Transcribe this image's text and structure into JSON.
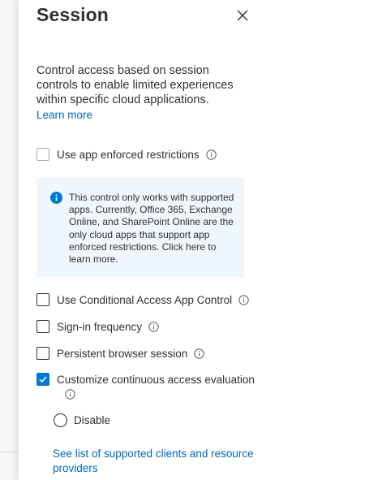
{
  "panel": {
    "title": "Session",
    "description": "Control access based on session controls to enable limited experiences within specific cloud applications.",
    "learn_more": "Learn more"
  },
  "options": [
    {
      "label": "Use app enforced restrictions",
      "checked": false,
      "icon": "info-icon"
    },
    {
      "label": "Use Conditional Access App Control",
      "checked": false,
      "icon": "info-icon"
    },
    {
      "label": "Sign-in frequency",
      "checked": false,
      "icon": "info-icon"
    },
    {
      "label": "Persistent browser session",
      "checked": false,
      "icon": "info-icon"
    },
    {
      "label": "Customize continuous access evaluation",
      "checked": true,
      "icon": "info-icon"
    }
  ],
  "info_box": {
    "icon": "info-filled-icon",
    "text": "This control only works with supported apps. Currently, Office 365, Exchange Online, and SharePoint Online are the only cloud apps that support app enforced restrictions. Click here to learn more."
  },
  "radio": {
    "label": "Disable",
    "selected": false
  },
  "supported_link": "See list of supported clients and resource providers",
  "colors": {
    "accent": "#0078d4",
    "link": "#0067b8",
    "info_bg": "#eff6fc",
    "text": "#323130"
  }
}
